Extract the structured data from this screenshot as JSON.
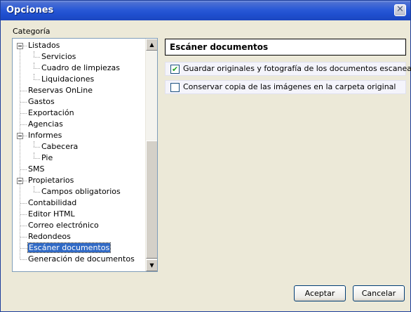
{
  "window": {
    "title": "Opciones"
  },
  "categoria_label": "Categoría",
  "tree": [
    {
      "label": "Listados",
      "level": 0,
      "expanded": true
    },
    {
      "label": "Servicios",
      "level": 1
    },
    {
      "label": "Cuadro de limpiezas",
      "level": 1
    },
    {
      "label": "Liquidaciones",
      "level": 1
    },
    {
      "label": "Reservas OnLine",
      "level": 0
    },
    {
      "label": "Gastos",
      "level": 0
    },
    {
      "label": "Exportación",
      "level": 0
    },
    {
      "label": "Agencias",
      "level": 0
    },
    {
      "label": "Informes",
      "level": 0,
      "expanded": true
    },
    {
      "label": "Cabecera",
      "level": 1
    },
    {
      "label": "Pie",
      "level": 1
    },
    {
      "label": "SMS",
      "level": 0
    },
    {
      "label": "Propietarios",
      "level": 0,
      "expanded": true
    },
    {
      "label": "Campos obligatorios",
      "level": 1
    },
    {
      "label": "Contabilidad",
      "level": 0
    },
    {
      "label": "Editor HTML",
      "level": 0
    },
    {
      "label": "Correo electrónico",
      "level": 0
    },
    {
      "label": "Redondeos",
      "level": 0
    },
    {
      "label": "Escáner documentos",
      "level": 0,
      "selected": true
    },
    {
      "label": "Generación de documentos",
      "level": 0
    }
  ],
  "panel": {
    "title": "Escáner documentos",
    "options": [
      {
        "label": "Guardar originales y fotografía de los documentos escaneados",
        "checked": true
      },
      {
        "label": "Conservar copia de las imágenes en la carpeta original",
        "checked": false
      }
    ]
  },
  "buttons": {
    "ok": "Aceptar",
    "cancel": "Cancelar"
  },
  "colors": {
    "selection": "#316ac5",
    "titlebar": "#2a59d6"
  }
}
